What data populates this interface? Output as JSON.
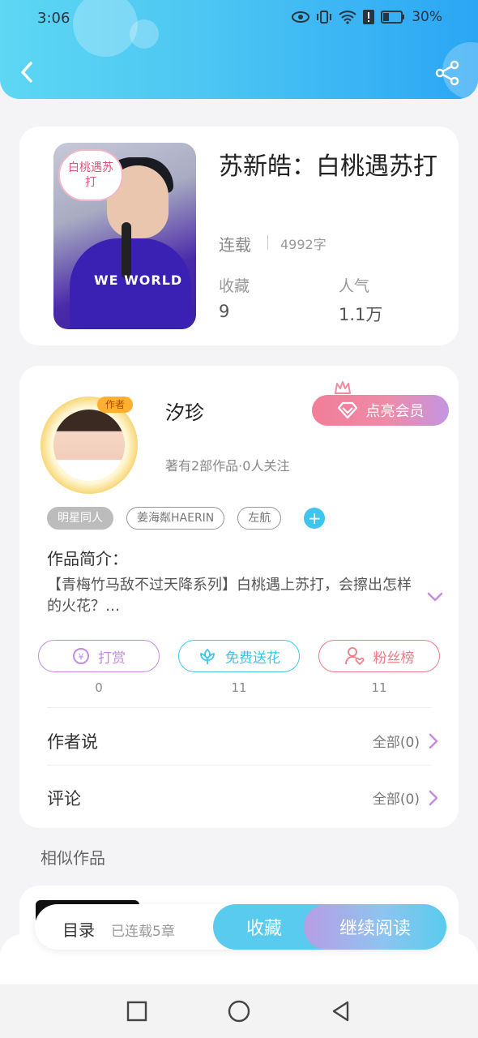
{
  "status_bar": {
    "time": "3:06",
    "battery": "30%"
  },
  "book": {
    "cover_caption": "白桃遇苏打",
    "cover_overlay_text": "WE WORLD",
    "title": "苏新皓：白桃遇苏打",
    "status": "连载",
    "word_count": "4992字",
    "favorites_label": "收藏",
    "favorites_value": "9",
    "popularity_label": "人气",
    "popularity_value": "1.1万"
  },
  "author": {
    "badge": "作者",
    "name": "汐珍",
    "meta": "著有2部作品·0人关注",
    "vip_button": "点亮会员"
  },
  "tags": [
    "明星同人",
    "姜海粼HAERIN",
    "左航"
  ],
  "intro": {
    "label": "作品简介：",
    "text": "【青梅竹马敌不过天降系列】白桃遇上苏打，会擦出怎样的火花？…"
  },
  "actions": [
    {
      "label": "打赏",
      "count": "0",
      "color": "#c48ce0"
    },
    {
      "label": "免费送花",
      "count": "11",
      "color": "#3ec5ee"
    },
    {
      "label": "粉丝榜",
      "count": "11",
      "color": "#ee7b86"
    }
  ],
  "rows": {
    "author_says": {
      "title": "作者说",
      "link": "全部(0)"
    },
    "comments": {
      "title": "评论",
      "link": "全部(0)"
    }
  },
  "similar": {
    "label": "相似作品"
  },
  "bottom_bar": {
    "toc": "目录",
    "toc_meta": "已连载5章",
    "favorite": "收藏",
    "continue_read": "继续阅读"
  }
}
